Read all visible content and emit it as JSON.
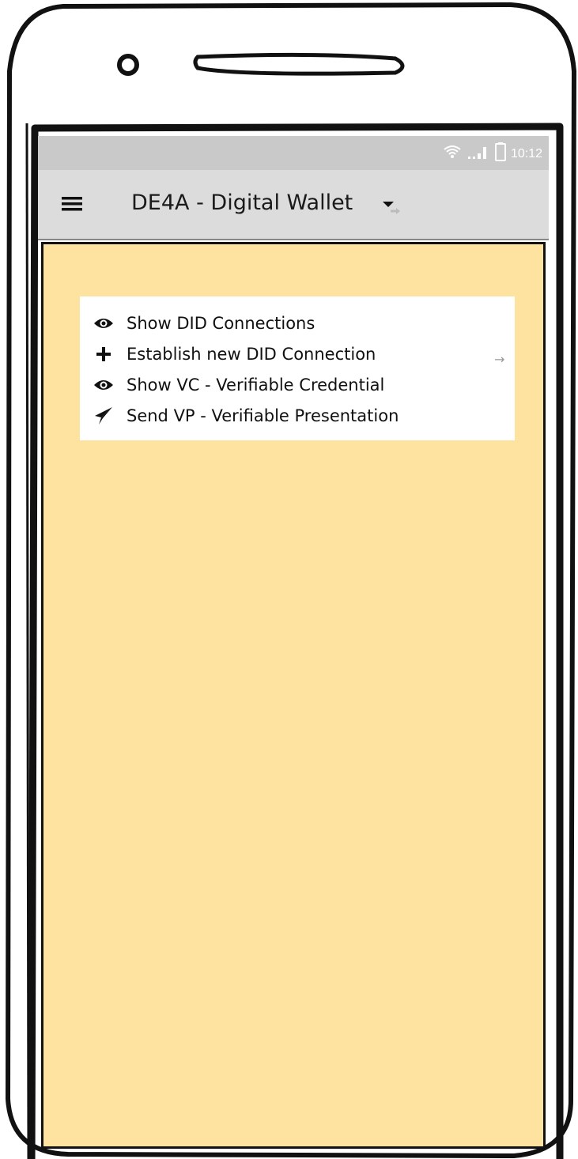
{
  "status_bar": {
    "time": "10:12",
    "icons": [
      "wifi-icon",
      "signal-icon",
      "battery-icon"
    ]
  },
  "app_bar": {
    "menu_icon": "hamburger-icon",
    "title": "DE4A - Digital Wallet",
    "dropdown_icon": "dropdown-link-icon"
  },
  "menu": {
    "items": [
      {
        "icon": "eye-icon",
        "label": "Show DID Connections"
      },
      {
        "icon": "plus-icon",
        "label": "Establish new DID Connection"
      },
      {
        "icon": "eye-icon",
        "label": "Show VC - Verifiable Credential"
      },
      {
        "icon": "paper-plane-icon",
        "label": "Send VP - Verifiable Presentation"
      }
    ],
    "link_arrow": "→"
  },
  "colors": {
    "content_background": "#fde39f",
    "app_bar_background": "#dcdcdc",
    "status_bar_background": "#c9c9c9",
    "frame": "#111111"
  }
}
